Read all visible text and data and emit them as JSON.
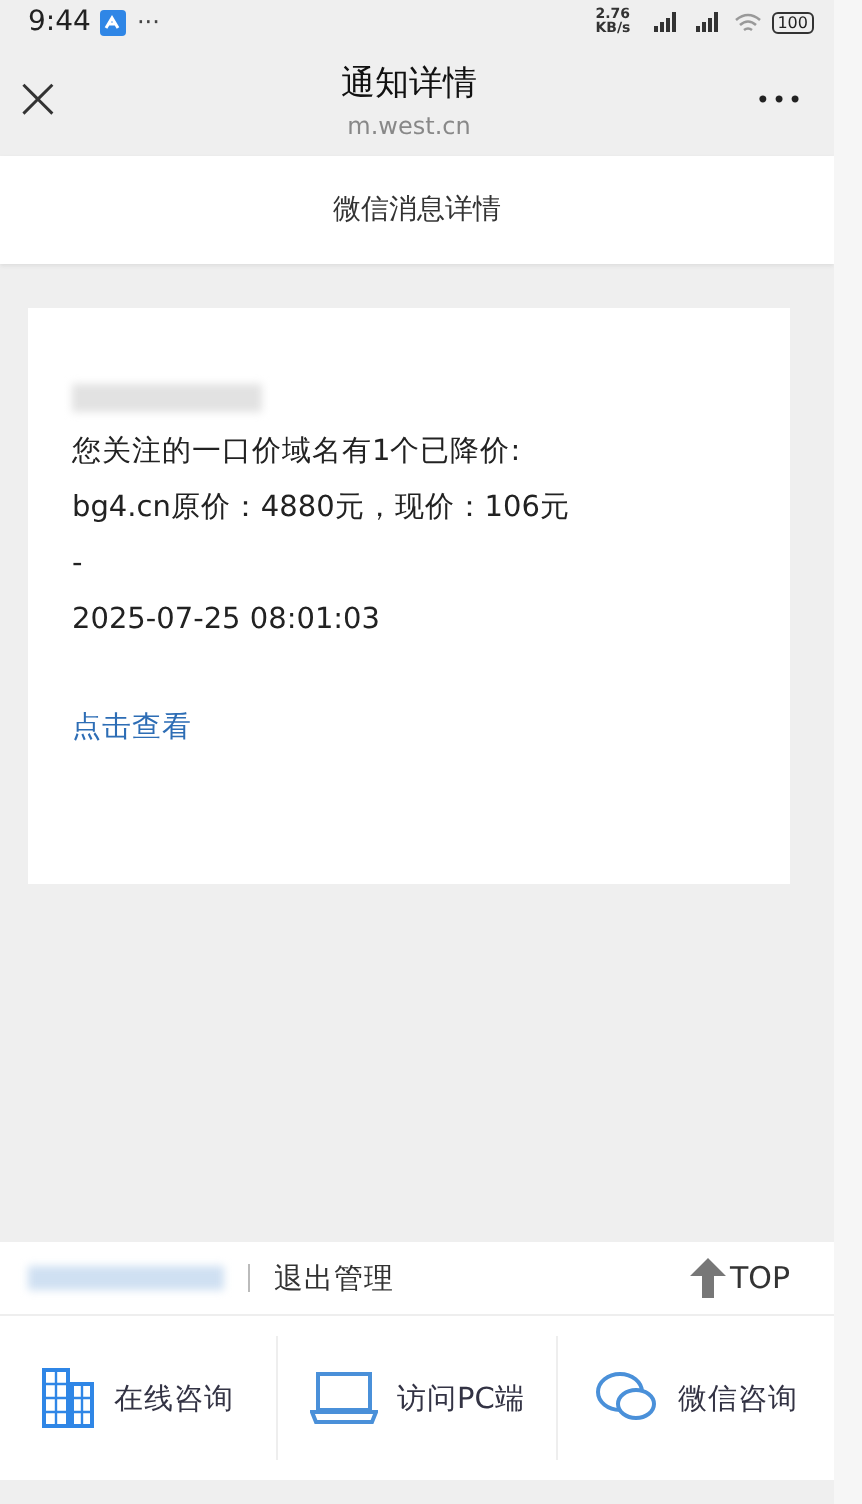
{
  "status_bar": {
    "time": "9:44",
    "more": "···",
    "speed": "2.76 KB/s",
    "battery": "100"
  },
  "header": {
    "close": "×",
    "title": "通知详情",
    "subtitle": "m.west.cn",
    "more": "•••"
  },
  "page_title": "微信消息详情",
  "message": {
    "lines": [
      "您关注的一口价域名有1个已降价:",
      "bg4.cn原价：4880元，现价：106元",
      "-",
      "2025-07-25 08:01:03"
    ],
    "link": "点击查看"
  },
  "footer": {
    "logout": "退出管理",
    "top": "TOP"
  },
  "bottom_nav": [
    {
      "kind": "building",
      "label": "在线咨询"
    },
    {
      "kind": "laptop",
      "label": "访问PC端"
    },
    {
      "kind": "chat",
      "label": "微信咨询"
    }
  ]
}
